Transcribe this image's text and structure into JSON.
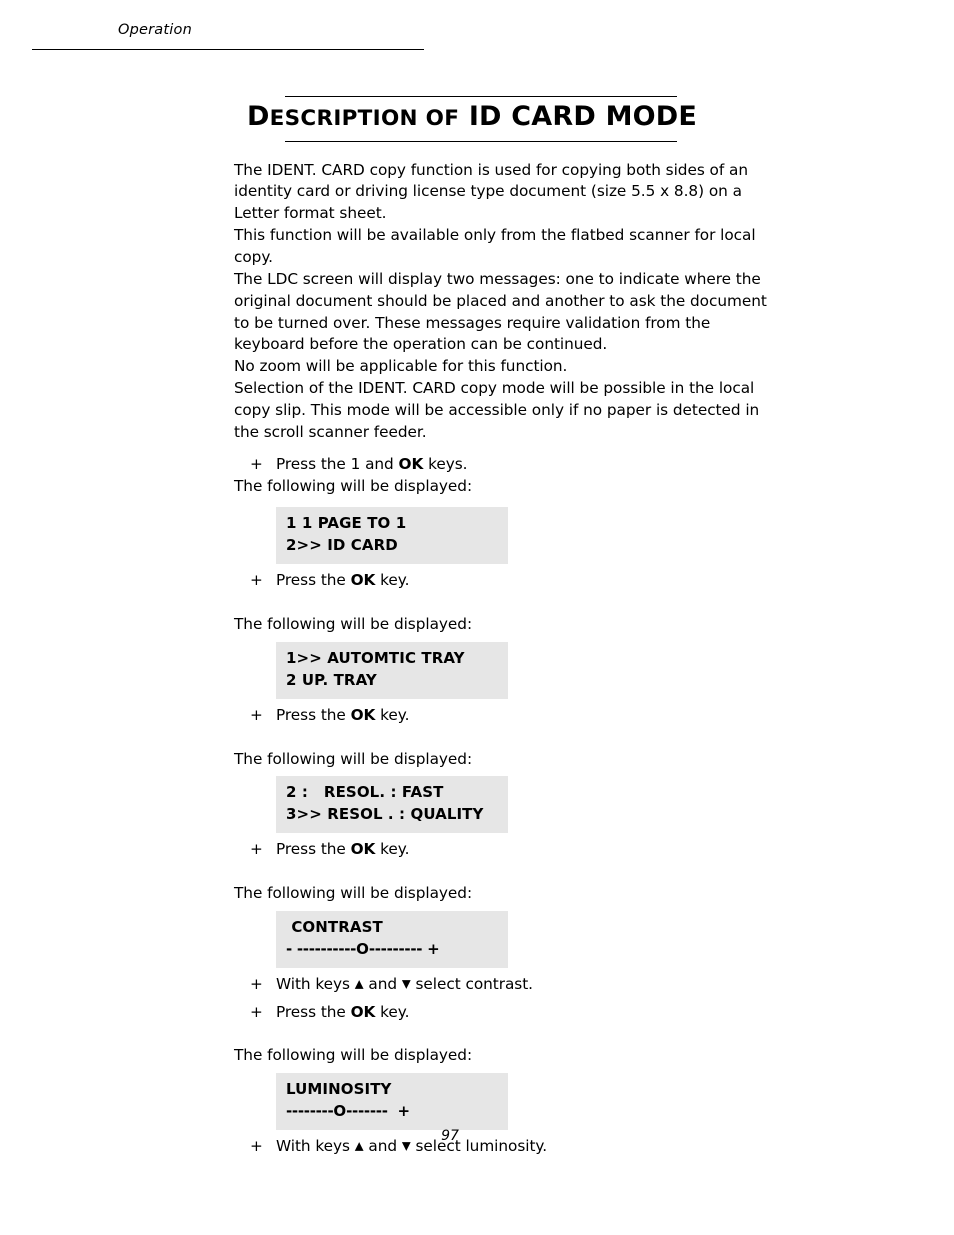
{
  "header": {
    "running_title": "Operation"
  },
  "title": {
    "part_initial": "D",
    "part_smallcaps": "ESCRIPTION",
    "part_of": "OF",
    "part_main": "ID CARD MODE",
    "full_text": "DESCRIPTION OF ID CARD MODE"
  },
  "paragraphs": [
    "The IDENT. CARD copy function is used for copying both sides of an identity card or driving license type document (size 5.5 x 8.8) on a Letter format sheet.",
    "This function will be available only from the flatbed scanner for local copy.",
    "The LDC screen will display two messages: one to indicate where the original document should be placed and another to ask the document to be turned over. These messages require validation from the keyboard before the operation can be continued.",
    "No zoom will be applicable for this function.",
    "Selection of the IDENT. CARD copy mode will be possible in the local copy slip. This mode will be accessible only if no paper is detected in the scroll scanner feeder."
  ],
  "bullets": {
    "press_1_ok_pre": "Press the 1 and ",
    "press_1_ok_bold": "OK",
    "press_1_ok_post": " keys.",
    "press_ok_pre_spaced": "Press the  ",
    "press_ok_pre": "Press the ",
    "press_ok_bold": "OK",
    "press_ok_post": " key.",
    "with_keys_pre": "With keys ",
    "with_keys_and": " and ",
    "select_contrast": " select contrast.",
    "select_luminosity": " select luminosity.",
    "marker": "+",
    "arrow_up": "▲",
    "arrow_down": "▼"
  },
  "intro_line": "The following will be displayed:",
  "lcd_screens": [
    {
      "id": "page-to-1",
      "line1": "1 1 PAGE TO 1",
      "line2": "2>> ID CARD"
    },
    {
      "id": "tray",
      "line1": "1>> AUTOMTIC TRAY",
      "line2": "2 UP. TRAY"
    },
    {
      "id": "resolution",
      "line1": "2 :   RESOL. : FAST",
      "line2": "3>> RESOL . : QUALITY"
    },
    {
      "id": "contrast",
      "line1": " CONTRAST",
      "line2": "- ----------O--------- +"
    },
    {
      "id": "luminosity",
      "line1": "LUMINOSITY",
      "line2": "--------O-------  +"
    }
  ],
  "page_number": "97",
  "colors": {
    "lcd_background": "#e6e6e6",
    "text": "#000000",
    "page_background": "#ffffff"
  }
}
